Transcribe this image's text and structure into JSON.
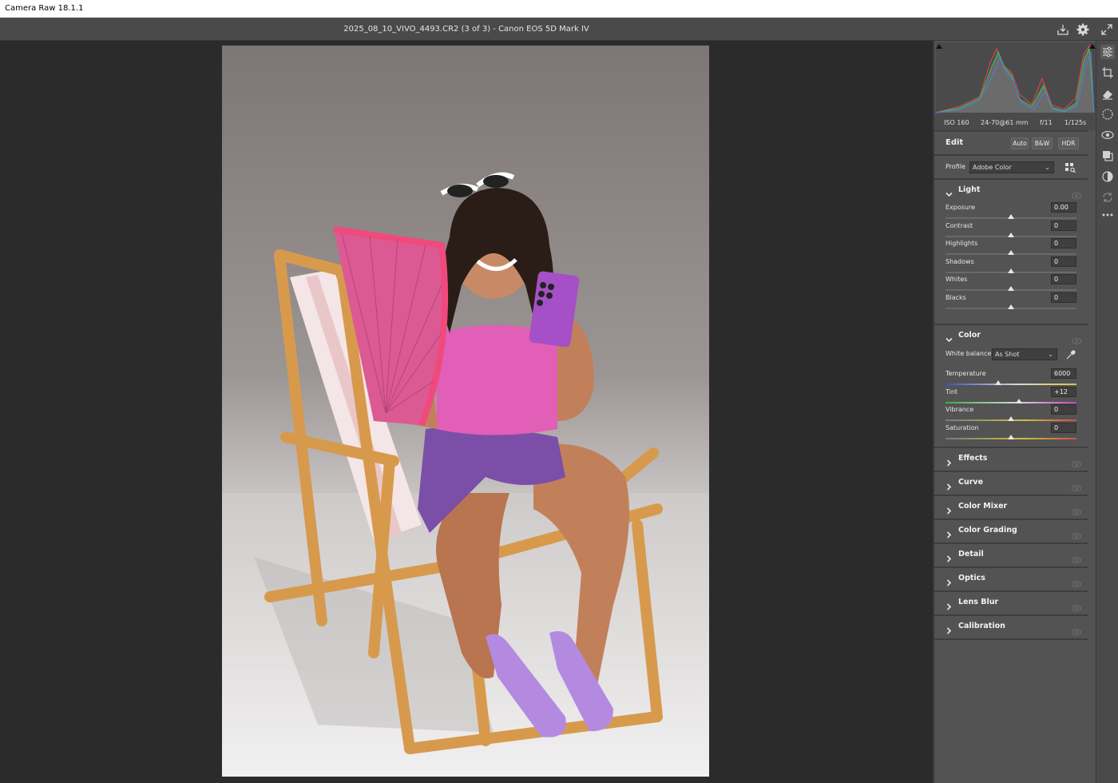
{
  "window": {
    "title": "Camera Raw 18.1.1"
  },
  "header": {
    "filename": "2025_08_10_VIVO_4493.CR2 (3 of 3)  -  Canon EOS 5D Mark IV"
  },
  "icons": {
    "save": "save-icon",
    "settings": "gear-icon",
    "fullscreen": "fullscreen-icon",
    "tools": [
      "edit-icon",
      "crop-icon",
      "eraser-icon",
      "mask-icon",
      "redeye-icon",
      "presets-icon",
      "snapshot-icon",
      "sync-icon",
      "more-icon"
    ]
  },
  "meta": {
    "iso": "ISO 160",
    "lens": "24-70@61 mm",
    "aperture": "f/11",
    "shutter": "1/125s"
  },
  "edit": {
    "title": "Edit",
    "buttons": {
      "auto": "Auto",
      "bw": "B&W",
      "hdr": "HDR"
    },
    "profile_label": "Profile",
    "profile_value": "Adobe Color"
  },
  "light": {
    "title": "Light",
    "sliders": [
      {
        "name": "Exposure",
        "value": "0.00",
        "pos": 0.5
      },
      {
        "name": "Contrast",
        "value": "0",
        "pos": 0.5
      },
      {
        "name": "Highlights",
        "value": "0",
        "pos": 0.5
      },
      {
        "name": "Shadows",
        "value": "0",
        "pos": 0.5
      },
      {
        "name": "Whites",
        "value": "0",
        "pos": 0.5
      },
      {
        "name": "Blacks",
        "value": "0",
        "pos": 0.5
      }
    ]
  },
  "color": {
    "title": "Color",
    "wb_label": "White balance",
    "wb_value": "As Shot",
    "sliders": [
      {
        "name": "Temperature",
        "value": "6000",
        "pos": 0.4
      },
      {
        "name": "Tint",
        "value": "+12",
        "pos": 0.56
      },
      {
        "name": "Vibrance",
        "value": "0",
        "pos": 0.5
      },
      {
        "name": "Saturation",
        "value": "0",
        "pos": 0.5
      }
    ]
  },
  "collapsed_sections": [
    "Effects",
    "Curve",
    "Color Mixer",
    "Color Grading",
    "Detail",
    "Optics",
    "Lens Blur",
    "Calibration"
  ],
  "colors": {
    "panel_bg": "#535353",
    "canvas_bg": "#2b2b2b",
    "accent": "#e6e6e6"
  }
}
